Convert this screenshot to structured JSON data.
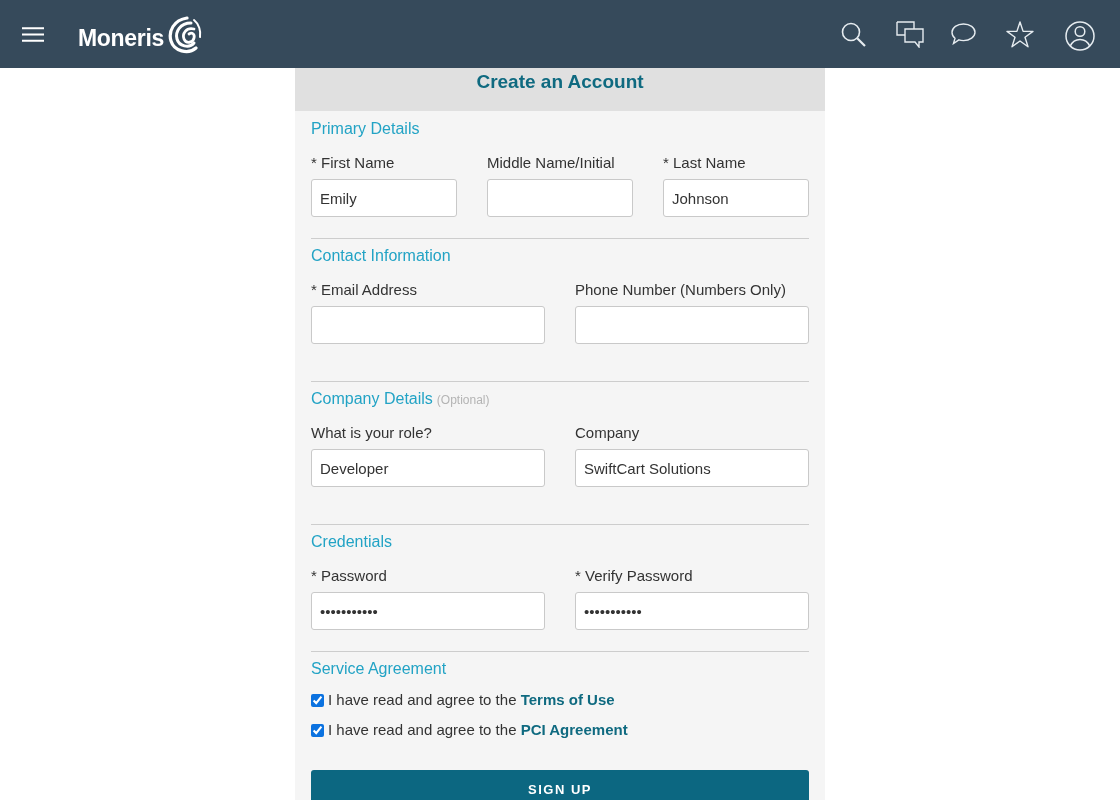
{
  "header": {
    "logo": "Moneris"
  },
  "form": {
    "title": "Create an Account",
    "sections": [
      {
        "kind": "fields",
        "heading": "Primary Details",
        "fields": [
          {
            "label": "* First Name",
            "value": "Emily"
          },
          {
            "label": "Middle Name/Initial"
          },
          {
            "label": "* Last Name",
            "value": "Johnson"
          }
        ]
      },
      {
        "kind": "fields",
        "heading": "Contact Information",
        "fields": [
          {
            "label": "* Email Address"
          },
          {
            "label": "Phone Number (Numbers Only)"
          }
        ]
      },
      {
        "kind": "fields",
        "heading": "Company Details",
        "note": "(Optional)",
        "fields": [
          {
            "label": "What is your role?",
            "value": "Developer"
          },
          {
            "label": "Company",
            "value": "SwiftCart Solutions"
          }
        ]
      },
      {
        "kind": "fields",
        "heading": "Credentials",
        "fields": [
          {
            "label": "* Password",
            "value": "•••••••••••"
          },
          {
            "label": "* Verify Password",
            "value": "•••••••••••"
          }
        ]
      },
      {
        "kind": "agreements",
        "heading": "Service Agreement",
        "items": [
          {
            "text": "I have read and agree to the",
            "link": "Terms of Use",
            "checked": true
          },
          {
            "text": "I have read and agree to the",
            "link": "PCI Agreement",
            "checked": true
          }
        ]
      }
    ],
    "submit": "SIGN UP"
  }
}
